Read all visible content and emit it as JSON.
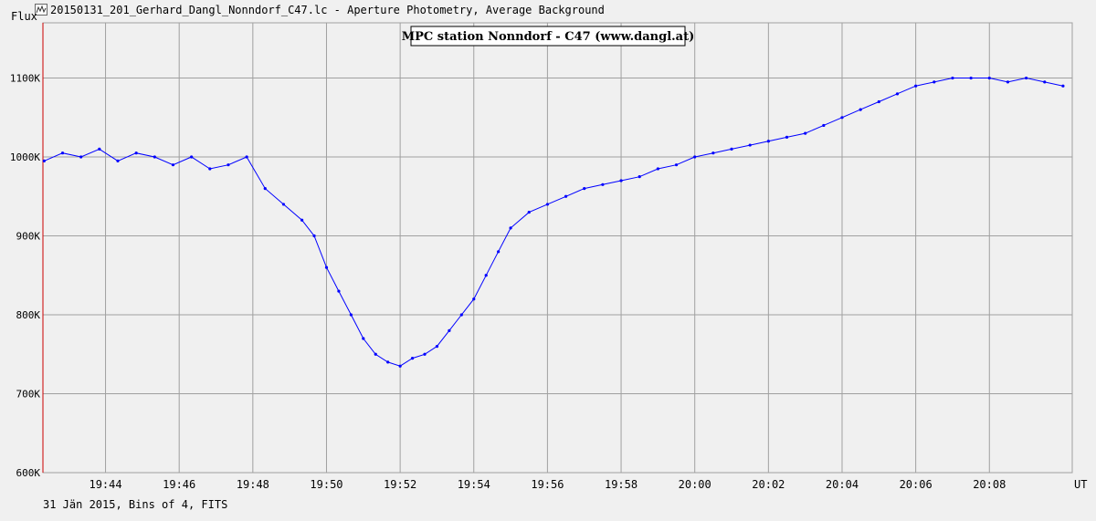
{
  "window": {
    "title": "20150131_201_Gerhard_Dangl_Nonndorf_C47.lc - Aperture Photometry, Average Background",
    "icon": "lightcurve-icon"
  },
  "footer": {
    "text": "31 Jän 2015, Bins of 4, FITS"
  },
  "colors": {
    "series": "#0000ff",
    "grid": "#a0a0a0",
    "background": "#f0f0f0",
    "marker": "#cc0000"
  },
  "chart_data": {
    "type": "line",
    "title": "MPC station Nonndorf - C47 (www.dangl.at)",
    "ylabel": "Flux",
    "xlabel": "UT",
    "ylim": [
      600,
      1170
    ],
    "y_unit": "K",
    "yticks": [
      {
        "value": 600,
        "label": "600K"
      },
      {
        "value": 700,
        "label": "700K"
      },
      {
        "value": 800,
        "label": "800K"
      },
      {
        "value": 900,
        "label": "900K"
      },
      {
        "value": 1000,
        "label": "1000K"
      },
      {
        "value": 1100,
        "label": "1100K"
      }
    ],
    "xlim": [
      "19:42:18",
      "20:10:15"
    ],
    "xticks": [
      {
        "time": "19:44",
        "label": "19:44"
      },
      {
        "time": "19:46",
        "label": "19:46"
      },
      {
        "time": "19:48",
        "label": "19:48"
      },
      {
        "time": "19:50",
        "label": "19:50"
      },
      {
        "time": "19:52",
        "label": "19:52"
      },
      {
        "time": "19:54",
        "label": "19:54"
      },
      {
        "time": "19:56",
        "label": "19:56"
      },
      {
        "time": "19:58",
        "label": "19:58"
      },
      {
        "time": "20:00",
        "label": "20:00"
      },
      {
        "time": "20:02",
        "label": "20:02"
      },
      {
        "time": "20:04",
        "label": "20:04"
      },
      {
        "time": "20:06",
        "label": "20:06"
      },
      {
        "time": "20:08",
        "label": "20:08"
      }
    ],
    "grid": true,
    "markers": true,
    "series": [
      {
        "x": [
          "19:42:20",
          "19:42:50",
          "19:43:20",
          "19:43:50",
          "19:44:20",
          "19:44:50",
          "19:45:20",
          "19:45:50",
          "19:46:20",
          "19:46:50",
          "19:47:20",
          "19:47:50",
          "19:48:20",
          "19:48:50",
          "19:49:20",
          "19:49:40",
          "19:50:00",
          "19:50:20",
          "19:50:40",
          "19:51:00",
          "19:51:20",
          "19:51:40",
          "19:52:00",
          "19:52:20",
          "19:52:40",
          "19:53:00",
          "19:53:20",
          "19:53:40",
          "19:54:00",
          "19:54:20",
          "19:54:40",
          "19:55:00",
          "19:55:30",
          "19:56:00",
          "19:56:30",
          "19:57:00",
          "19:57:30",
          "19:58:00",
          "19:58:30",
          "19:59:00",
          "19:59:30",
          "20:00:00",
          "20:00:30",
          "20:01:00",
          "20:01:30",
          "20:02:00",
          "20:02:30",
          "20:03:00",
          "20:03:30",
          "20:04:00",
          "20:04:30",
          "20:05:00",
          "20:05:30",
          "20:06:00",
          "20:06:30",
          "20:07:00",
          "20:07:30",
          "20:08:00",
          "20:08:30",
          "20:09:00",
          "20:09:30",
          "20:10:00"
        ],
        "y": [
          995,
          1005,
          1000,
          1010,
          995,
          1005,
          1000,
          990,
          1000,
          985,
          990,
          1000,
          960,
          940,
          920,
          900,
          860,
          830,
          800,
          770,
          750,
          740,
          735,
          745,
          750,
          760,
          780,
          800,
          820,
          850,
          880,
          910,
          930,
          940,
          950,
          960,
          965,
          970,
          975,
          985,
          990,
          1000,
          1005,
          1010,
          1015,
          1020,
          1025,
          1030,
          1040,
          1050,
          1060,
          1070,
          1080,
          1090,
          1095,
          1100,
          1100,
          1100,
          1095,
          1100,
          1095,
          1090
        ]
      }
    ]
  }
}
